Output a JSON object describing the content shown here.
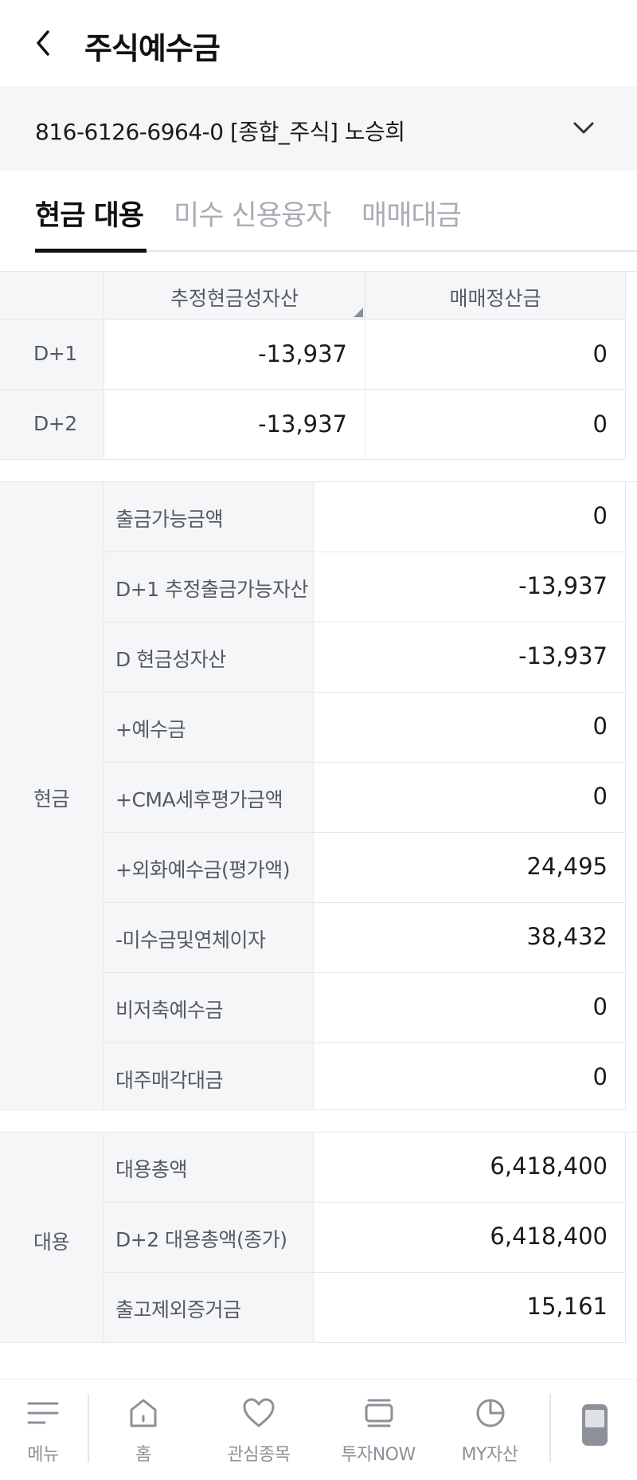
{
  "header": {
    "title": "주식예수금",
    "back_icon": "chevron-left-icon"
  },
  "account": {
    "label": "816-6126-6964-0  [종합_주식] 노승희",
    "dropdown_icon": "chevron-down-icon"
  },
  "tabs": [
    {
      "label": "현금 대용",
      "active": true
    },
    {
      "label": "미수 신용융자",
      "active": false
    },
    {
      "label": "매매대금",
      "active": false
    }
  ],
  "summary": {
    "headers": [
      "추정현금성자산",
      "매매정산금"
    ],
    "rows": [
      {
        "label": "D+1",
        "values": [
          "-13,937",
          "0"
        ]
      },
      {
        "label": "D+2",
        "values": [
          "-13,937",
          "0"
        ]
      }
    ]
  },
  "cash": {
    "group_label": "현금",
    "rows": [
      {
        "label": "출금가능금액",
        "value": "0"
      },
      {
        "label": "D+1 추정출금가능자산",
        "value": "-13,937"
      },
      {
        "label": "D 현금성자산",
        "value": "-13,937"
      },
      {
        "label": "+예수금",
        "value": "0"
      },
      {
        "label": "+CMA세후평가금액",
        "value": "0"
      },
      {
        "label": "+외화예수금(평가액)",
        "value": "24,495"
      },
      {
        "label": "-미수금및연체이자",
        "value": "38,432"
      },
      {
        "label": "비저축예수금",
        "value": "0"
      },
      {
        "label": "대주매각대금",
        "value": "0"
      }
    ]
  },
  "substitute": {
    "group_label": "대용",
    "rows": [
      {
        "label": "대용총액",
        "value": "6,418,400"
      },
      {
        "label": "D+2 대용총액(종가)",
        "value": "6,418,400"
      },
      {
        "label": "출고제외증거금",
        "value": "15,161"
      }
    ]
  },
  "bottom_nav": [
    {
      "label": "메뉴",
      "icon": "menu-icon"
    },
    {
      "label": "홈",
      "icon": "home-icon"
    },
    {
      "label": "관심종목",
      "icon": "heart-icon"
    },
    {
      "label": "투자NOW",
      "icon": "news-icon"
    },
    {
      "label": "MY자산",
      "icon": "pie-chart-icon"
    },
    {
      "label": "",
      "icon": "device-icon"
    }
  ]
}
